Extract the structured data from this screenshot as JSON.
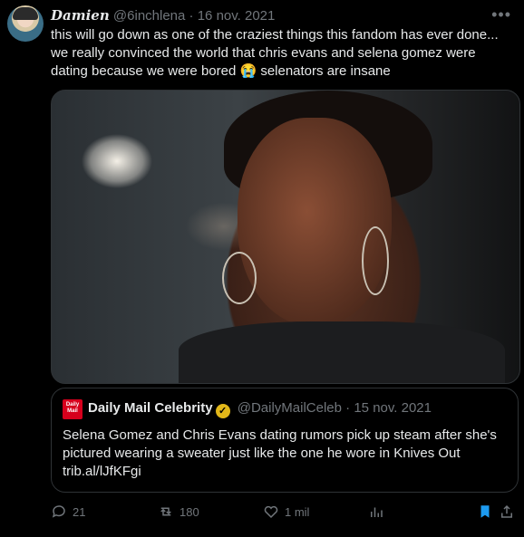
{
  "tweet": {
    "author_name": "Damien",
    "handle": "@6inchlena",
    "separator": "·",
    "date": "16 nov. 2021",
    "text": "this will go down as one of the craziest things this fandom has ever done... we really convinced the world that chris evans and selena gomez were dating because we were bored 😭 selenators are insane"
  },
  "quote": {
    "logo_text": "Daily Mail",
    "author_name": "Daily Mail Celebrity",
    "handle": "@DailyMailCeleb",
    "separator": "·",
    "date": "15 nov. 2021",
    "text": "Selena Gomez and Chris Evans dating rumors pick up steam after she's pictured wearing a sweater just like the one he wore in Knives Out trib.al/lJfKFgi"
  },
  "actions": {
    "replies": "21",
    "retweets": "180",
    "likes": "1 mil"
  },
  "colors": {
    "background": "#000000",
    "text": "#e7e9ea",
    "muted": "#71767b",
    "bookmark": "#1d9bf0",
    "logo_red": "#d6001c",
    "verified_gold": "#e2b719"
  },
  "icons": [
    "more-icon",
    "reply-icon",
    "retweet-icon",
    "like-icon",
    "views-icon",
    "bookmark-icon",
    "share-icon",
    "verified-badge-icon"
  ]
}
